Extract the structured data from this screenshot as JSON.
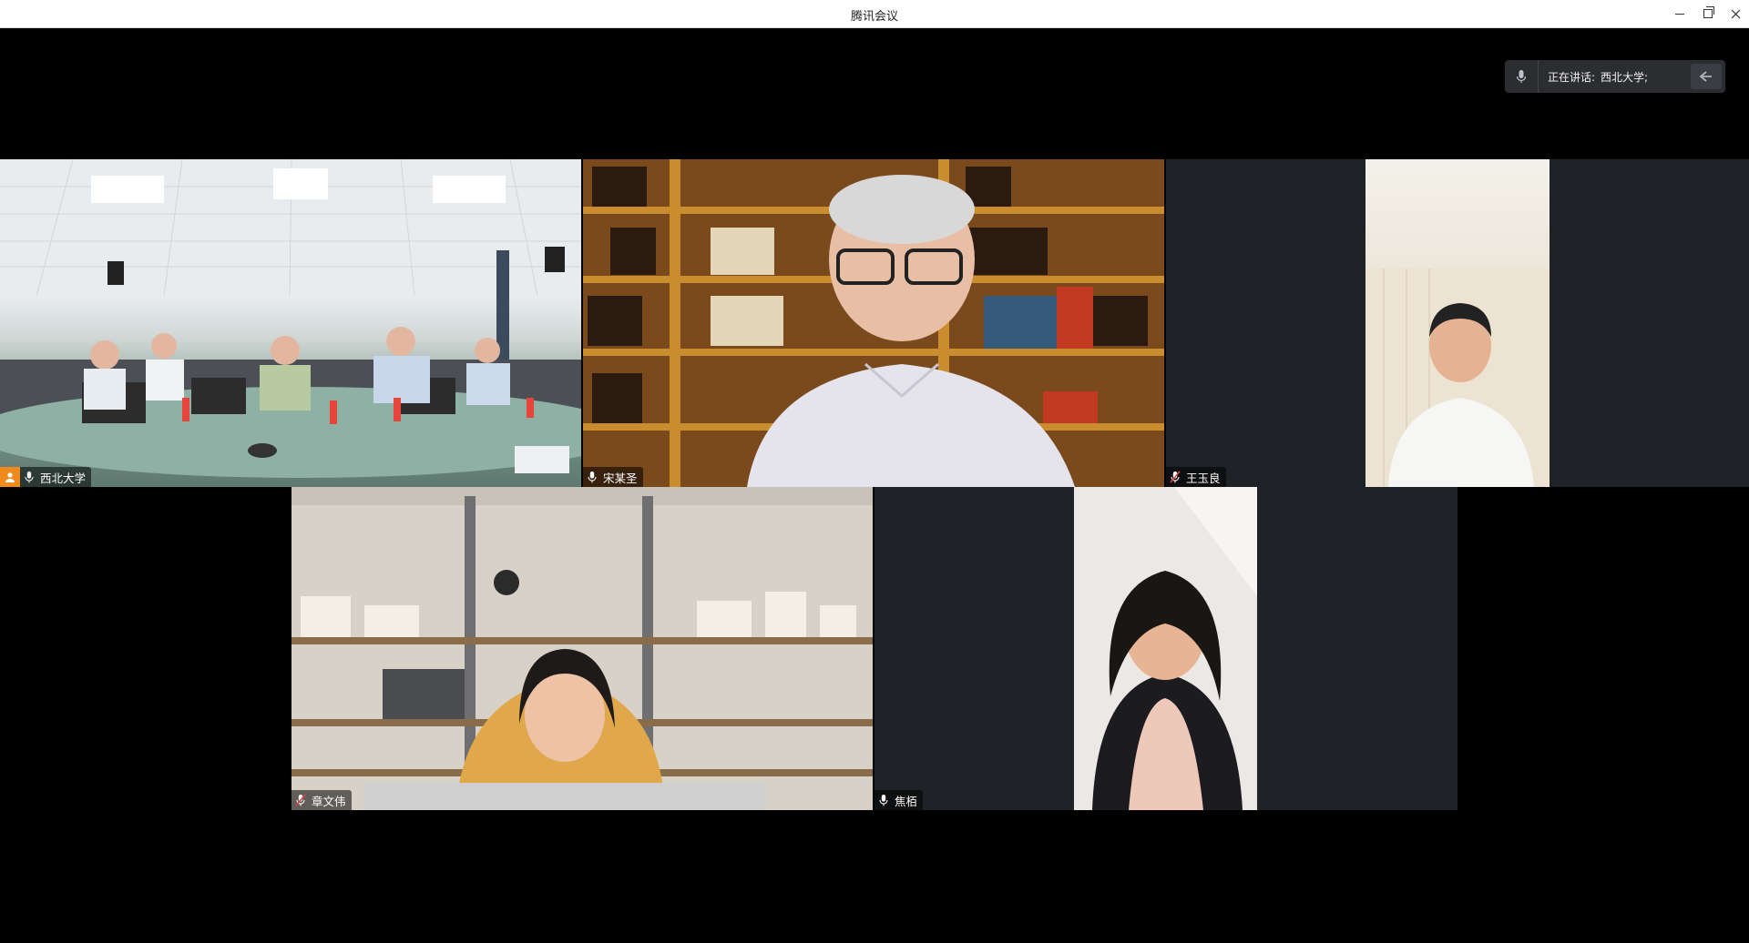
{
  "window": {
    "title": "腾讯会议"
  },
  "speaking": {
    "label": "正在讲话:",
    "name": "西北大学;"
  },
  "participants": [
    {
      "name": "西北大学",
      "host": true,
      "muted": false
    },
    {
      "name": "宋某圣",
      "host": false,
      "muted": false
    },
    {
      "name": "王玉良",
      "host": false,
      "muted": true
    },
    {
      "name": "章文伟",
      "host": false,
      "muted": true
    },
    {
      "name": "焦栢",
      "host": false,
      "muted": false
    }
  ],
  "colors": {
    "accent": "#1fb26b",
    "host_badge": "#f08a1c",
    "tile_bg": "#1f2227"
  }
}
